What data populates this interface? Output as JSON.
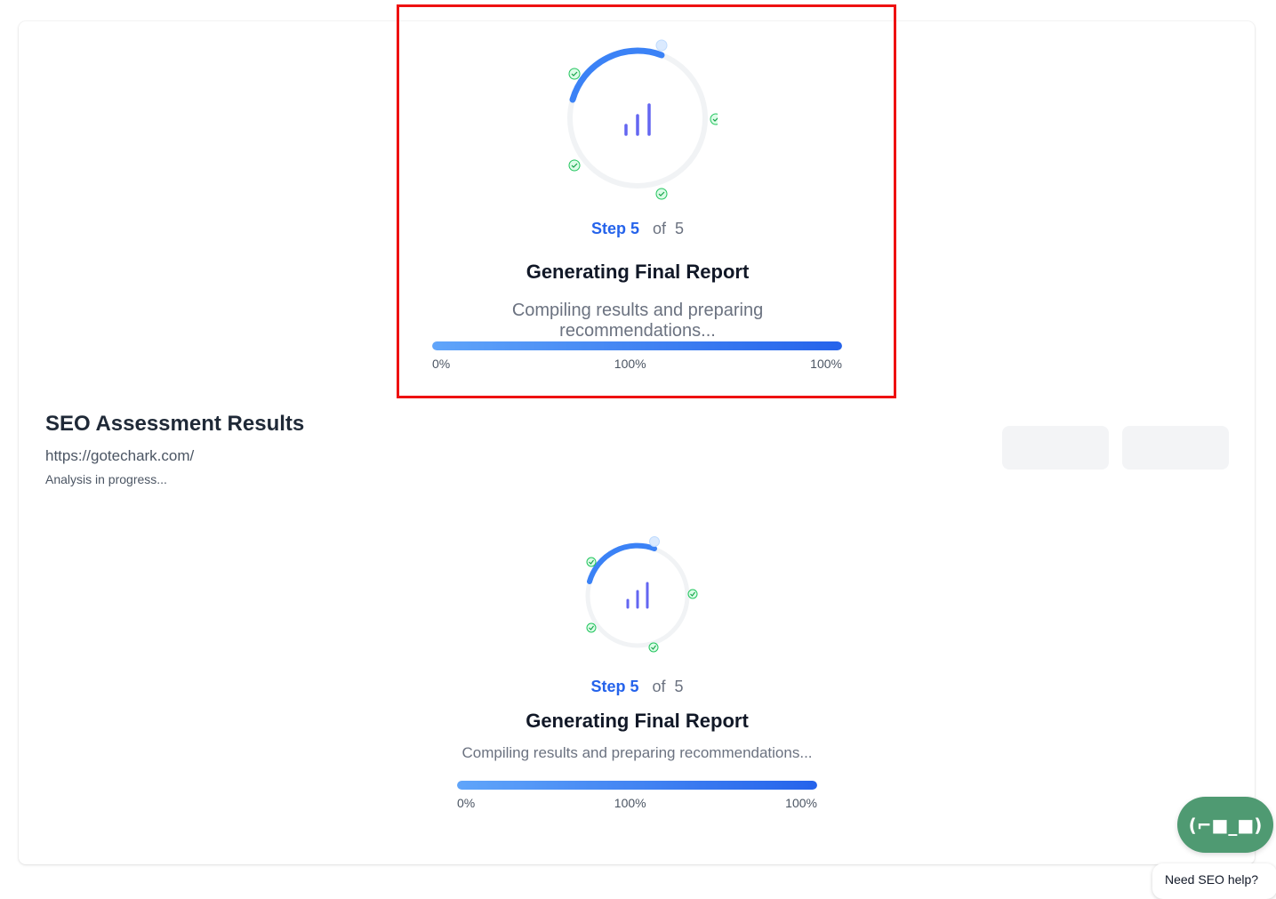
{
  "loader": {
    "step_word": "Step 5",
    "of_word": "of",
    "total_steps": "5",
    "title": "Generating Final Report",
    "description": "Compiling results and preparing recommendations...",
    "progress_fraction": 1.0,
    "progress_labels": [
      "0%",
      "100%",
      "100%"
    ]
  },
  "results": {
    "title": "SEO Assessment Results",
    "url": "https://gotechark.com/",
    "status": "Analysis in progress..."
  },
  "chat": {
    "button_label": "(⌐■_■)",
    "help_text": "Need SEO help?"
  },
  "colors": {
    "accent": "#2563eb",
    "ring_progress": "#3b82f6",
    "ring_track": "#f1f3f5",
    "chart_icon": "#6366f1",
    "check_badge": "#22c55e",
    "chat_button": "#4f9a72",
    "highlight_box": "#ee1111"
  }
}
